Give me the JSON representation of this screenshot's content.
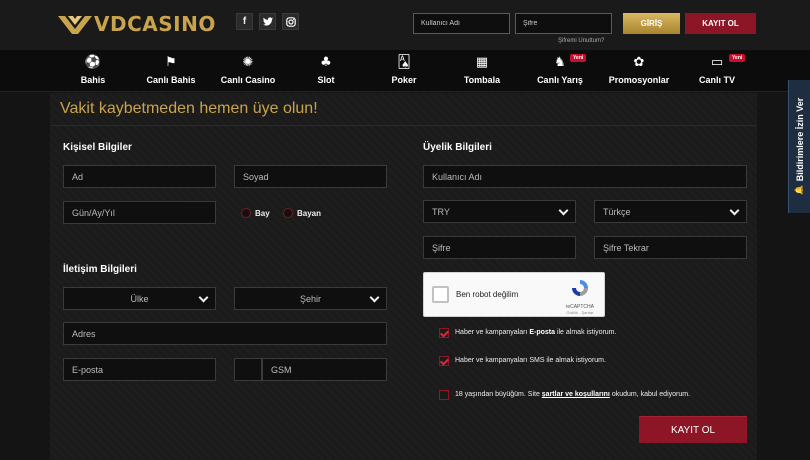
{
  "header": {
    "logo_text": "VDCASINO",
    "social": [
      {
        "icon": "facebook-icon",
        "glyph": "f"
      },
      {
        "icon": "twitter-icon",
        "glyph": "🐦"
      },
      {
        "icon": "instagram-icon",
        "glyph": "◎"
      }
    ],
    "username_placeholder": "Kullanıcı Adı",
    "password_placeholder": "Şifre",
    "forgot_password": "Şifremi Unuttum?",
    "login_label": "GİRİŞ",
    "register_label": "KAYIT OL"
  },
  "nav": {
    "items": [
      {
        "label": "Bahis",
        "icon": "soccer-ball-icon",
        "glyph": "⚽"
      },
      {
        "label": "Canlı Bahis",
        "icon": "flag-icon",
        "glyph": "⚑"
      },
      {
        "label": "Canlı Casino",
        "icon": "roulette-icon",
        "glyph": "✺"
      },
      {
        "label": "Slot",
        "icon": "slot-icon",
        "glyph": "♣"
      },
      {
        "label": "Poker",
        "icon": "poker-card-icon",
        "glyph": "🂡"
      },
      {
        "label": "Tombala",
        "icon": "tombala-icon",
        "glyph": "▦"
      },
      {
        "label": "Canlı Yarış",
        "icon": "horse-icon",
        "glyph": "♞",
        "badge": "Yeni"
      },
      {
        "label": "Promosyonlar",
        "icon": "gift-icon",
        "glyph": "✿"
      },
      {
        "label": "Canlı TV",
        "icon": "tv-icon",
        "glyph": "▭",
        "badge": "Yeni"
      }
    ]
  },
  "page": {
    "title": "Vakit kaybetmeden hemen üye olun!"
  },
  "personal": {
    "title": "Kişisel Bilgiler",
    "first_name": "Ad",
    "last_name": "Soyad",
    "birth_date": "Gün/Ay/Yıl",
    "gender_male": "Bay",
    "gender_female": "Bayan"
  },
  "contact": {
    "title": "İletişim Bilgileri",
    "country": "Ülke",
    "city": "Şehir",
    "address": "Adres",
    "email": "E-posta",
    "gsm": "GSM"
  },
  "membership": {
    "title": "Üyelik Bilgileri",
    "username": "Kullanıcı Adı",
    "currency": "TRY",
    "language": "Türkçe",
    "password": "Şifre",
    "password_repeat": "Şifre Tekrar"
  },
  "captcha": {
    "label": "Ben robot değilim",
    "brand": "reCAPTCHA",
    "links": "Gizlilik - Şartlar"
  },
  "consents": {
    "email_pre": "Haber ve kampanyaları ",
    "email_bold": "E-posta",
    "email_post": " ile almak istiyorum.",
    "email_checked": true,
    "sms_text": "Haber ve kampanyaları SMS ile almak istiyorum.",
    "sms_checked": true,
    "age_pre": "18 yaşından büyüğüm. Site ",
    "age_link": "şartlar ve koşullarını",
    "age_post": " okudum, kabul ediyorum.",
    "age_checked": false
  },
  "submit_label": "KAYIT OL",
  "side_tab": {
    "label": "Bildirimlere İzin Ver",
    "icon": "bell-icon"
  },
  "colors": {
    "gold": "#c9a44c",
    "burgundy": "#8c1626",
    "background": "#141414"
  }
}
